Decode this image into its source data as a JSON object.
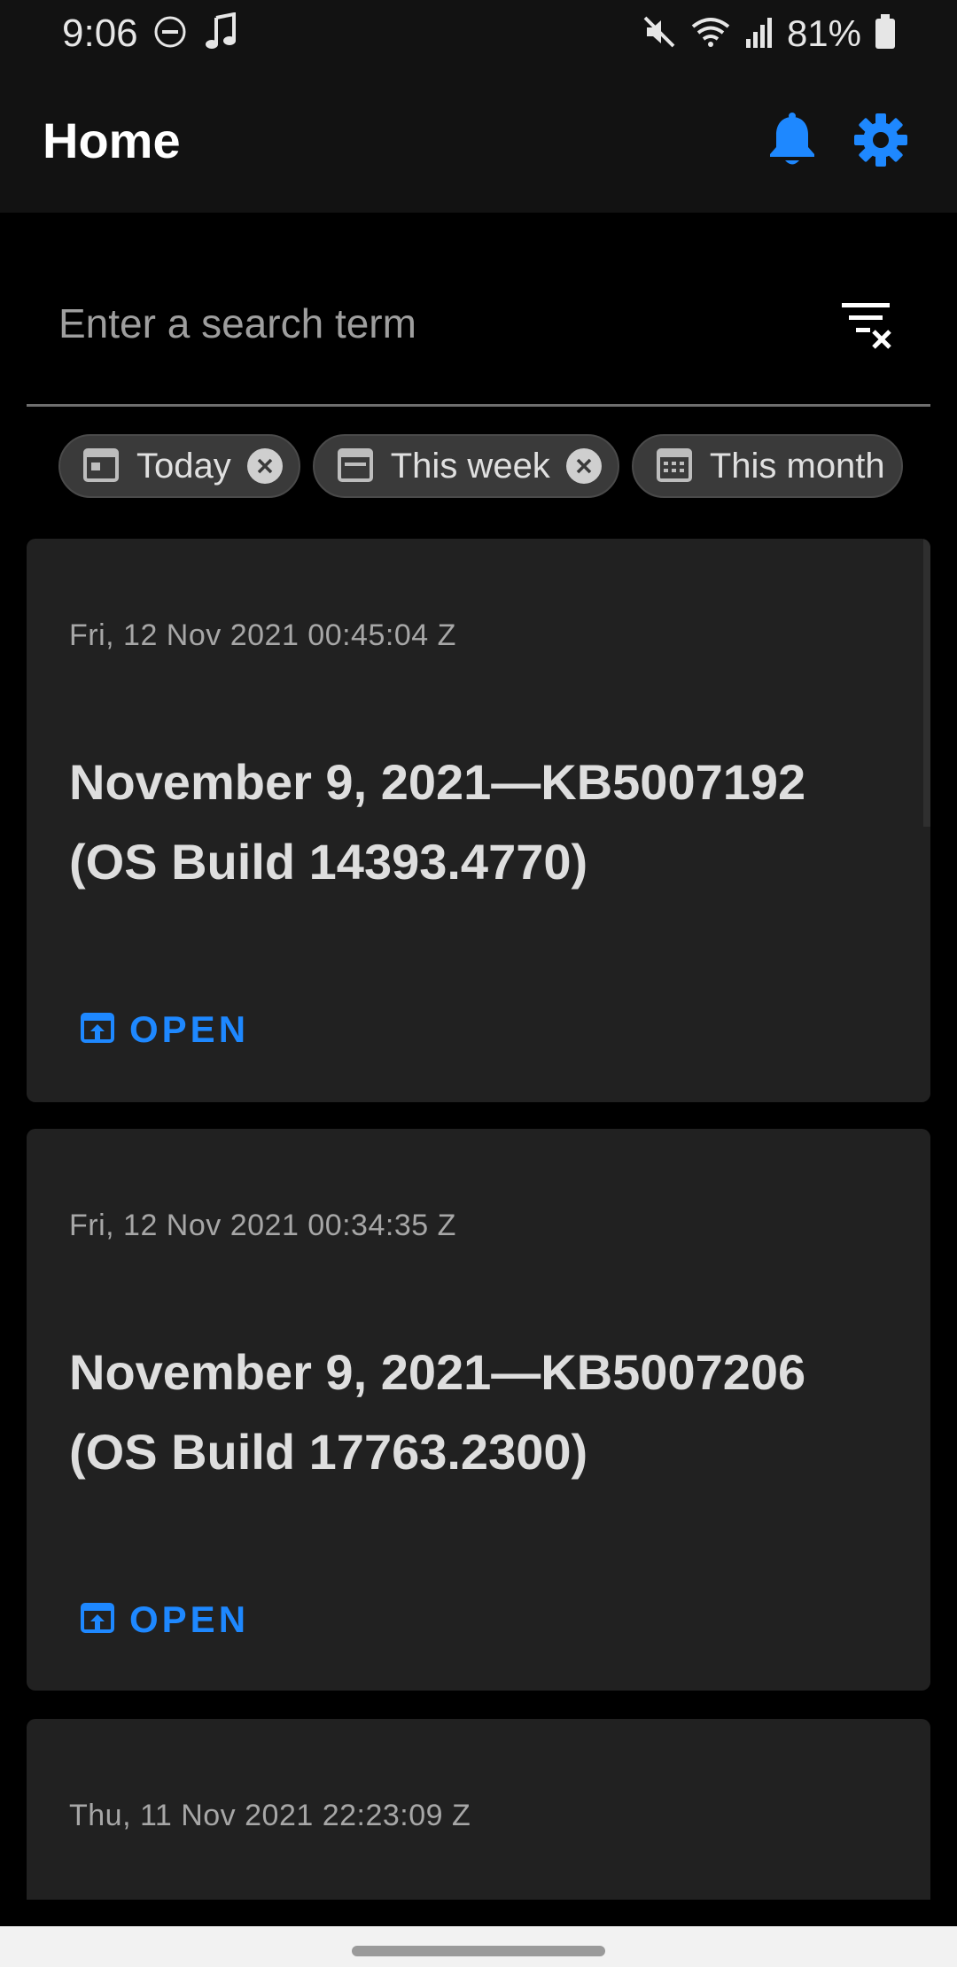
{
  "status_bar": {
    "time": "9:06",
    "battery": "81%",
    "left_icons": [
      "dnd-icon",
      "music-note-icon"
    ],
    "right_icons": [
      "mute-icon",
      "wifi-icon",
      "signal-icon",
      "battery-icon"
    ]
  },
  "app_bar": {
    "title": "Home",
    "accent_color": "#1e88ff",
    "actions": [
      "bell-icon",
      "gear-icon"
    ]
  },
  "search": {
    "placeholder": "Enter a search term",
    "value": ""
  },
  "chips": [
    {
      "label": "Today",
      "icon": "calendar-day-icon",
      "closable": true
    },
    {
      "label": "This week",
      "icon": "calendar-week-icon",
      "closable": true
    },
    {
      "label": "This month",
      "icon": "calendar-month-icon",
      "closable": false
    }
  ],
  "cards": [
    {
      "date": "Fri, 12 Nov 2021 00:45:04 Z",
      "title": "November 9, 2021—KB5007192 (OS Build 14393.4770)",
      "action": "OPEN"
    },
    {
      "date": "Fri, 12 Nov 2021 00:34:35 Z",
      "title": "November 9, 2021—KB5007206 (OS Build 17763.2300)",
      "action": "OPEN"
    },
    {
      "date": "Thu, 11 Nov 2021 22:23:09 Z",
      "title": "",
      "action": ""
    }
  ]
}
